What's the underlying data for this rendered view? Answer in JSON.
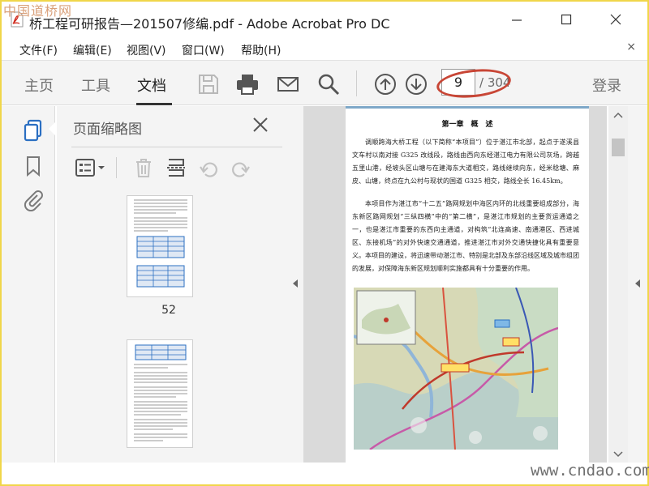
{
  "watermark_top": "中国道桥网",
  "watermark_bottom": "www.cndao.com",
  "window": {
    "title": "桥工程可研报告—201507修编.pdf - Adobe Acrobat Pro DC"
  },
  "menu": {
    "items": [
      "文件(F)",
      "编辑(E)",
      "视图(V)",
      "窗口(W)",
      "帮助(H)"
    ],
    "close": "×"
  },
  "toolbar": {
    "tabs": [
      "主页",
      "工具",
      "文档"
    ],
    "active_tab": "文档",
    "page_current": "9",
    "page_total": "/ 304",
    "login": "登录"
  },
  "thumbnails_panel": {
    "title": "页面缩略图",
    "page_label": "52"
  },
  "document": {
    "chapter_title": "第一章　概　述",
    "paragraphs": [
      "调顺跨海大桥工程（以下简称“本项目”）位于湛江市北部，起点于遂溪县文车村以南对接 G325 改线段，路线由西向东经湛江电力有限公司灰场，跨越五里山港，经坡头区山塘与在建海东大道相交，路线继续向东，经米稔塘、麻皮、山塘，终点在九公村与现状的国道 G325 相交，路线全长 16.45km。",
      "本项目作为湛江市“十二五”路网规划中海区内环的北线重要组成部分，海东新区路网规划“三纵四横”中的“第二横”，是湛江市规划的主要货运通道之一，也是湛江市重要的东西向主通道，对构筑“北连高速、南通港区、西进城区、东接机场”的对外快速交通通道，推进湛江市对外交通快捷化具有重要意义。本项目的建设，将迅速带动湛江市、特别是北部及东部沿线区域及城市组团的发展，对保障海东新区规划顺利实施都具有十分重要的作用。"
    ]
  },
  "colors": {
    "accent_blue": "#2b6fc2",
    "oval_red": "#c84636",
    "watermark_gold": "#f0d64a"
  }
}
